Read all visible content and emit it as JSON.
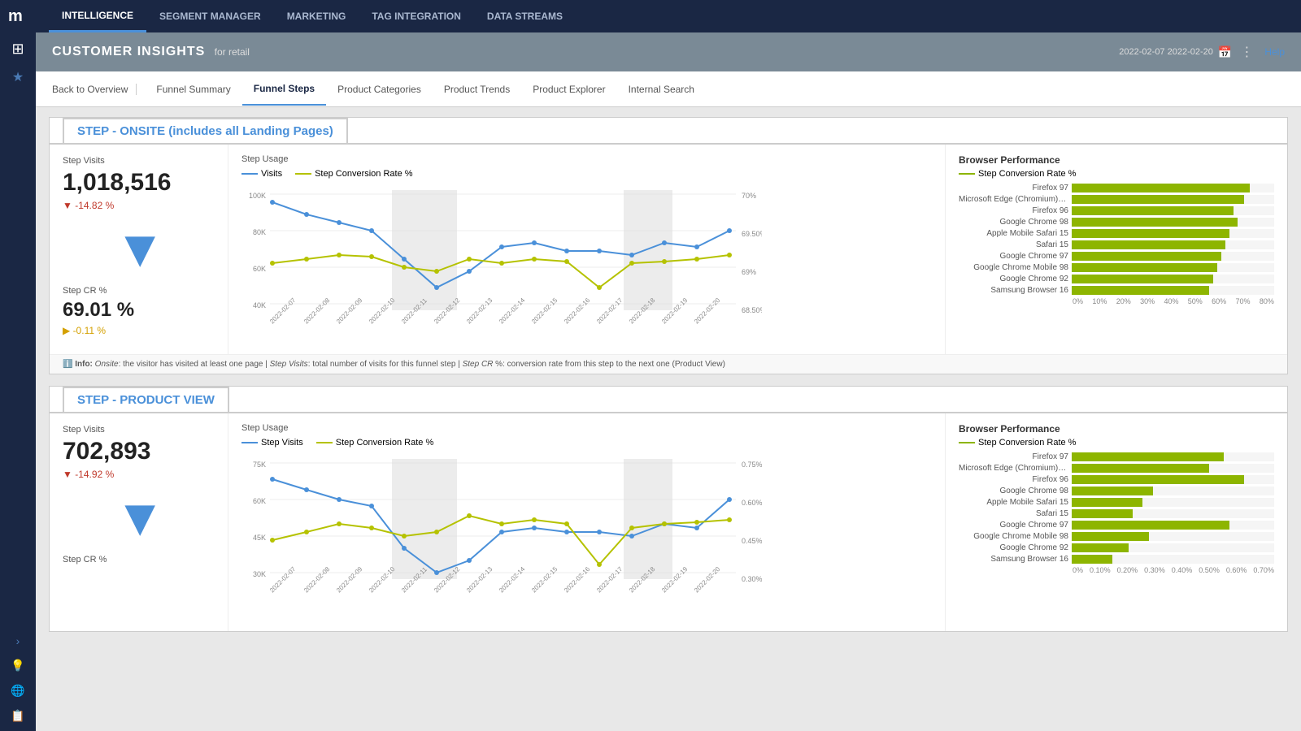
{
  "nav": {
    "logo": "m",
    "items": [
      "INTELLIGENCE",
      "SEGMENT MANAGER",
      "MARKETING",
      "TAG INTEGRATION",
      "DATA STREAMS"
    ],
    "active": "INTELLIGENCE"
  },
  "date_range": "2022-02-07 2022-02-20",
  "header": {
    "title": "CUSTOMER INSIGHTS",
    "subtitle": "for retail",
    "help": "Help"
  },
  "tabs": {
    "back": "Back to Overview",
    "items": [
      "Funnel Summary",
      "Funnel Steps",
      "Product Categories",
      "Product Trends",
      "Product Explorer",
      "Internal Search"
    ],
    "active": "Funnel Steps"
  },
  "step1": {
    "title": "STEP - ONSITE (includes all Landing Pages)",
    "visits_label": "Step Visits",
    "visits_value": "1,018,516",
    "visits_change": "▼ -14.82 %",
    "cr_label": "Step CR %",
    "cr_value": "69.01 %",
    "cr_change": "▶ -0.11 %",
    "usage_title": "Step Usage",
    "legend_visits": "Visits",
    "legend_cr": "Step Conversion Rate %",
    "browser_title": "Browser Performance",
    "browser_legend": "Step Conversion Rate %",
    "browsers": [
      {
        "name": "Firefox 97",
        "pct": 88
      },
      {
        "name": "Microsoft Edge (Chromium) fo...",
        "pct": 85
      },
      {
        "name": "Firefox 96",
        "pct": 80
      },
      {
        "name": "Google Chrome 98",
        "pct": 82
      },
      {
        "name": "Apple Mobile Safari 15",
        "pct": 78
      },
      {
        "name": "Safari 15",
        "pct": 76
      },
      {
        "name": "Google Chrome 97",
        "pct": 74
      },
      {
        "name": "Google Chrome Mobile 98",
        "pct": 72
      },
      {
        "name": "Google Chrome 92",
        "pct": 70
      },
      {
        "name": "Samsung Browser 16",
        "pct": 68
      }
    ],
    "axis_labels": [
      "0%",
      "10%",
      "20%",
      "30%",
      "40%",
      "50%",
      "60%",
      "70%",
      "80%"
    ],
    "info": "Info: Onsite: the visitor has visited at least one page | Step Visits: total number of visits for this funnel step | Step CR %: conversion rate from this step to the next one (Product View)"
  },
  "step2": {
    "title": "STEP - PRODUCT VIEW",
    "visits_label": "Step Visits",
    "visits_value": "702,893",
    "visits_change": "▼ -14.92 %",
    "cr_label": "Step CR %",
    "usage_title": "Step Usage",
    "legend_visits": "Step Visits",
    "legend_cr": "Step Conversion Rate %",
    "browser_title": "Browser Performance",
    "browser_legend": "Step Conversion Rate %",
    "browsers": [
      {
        "name": "Firefox 97",
        "pct": 75
      },
      {
        "name": "Microsoft Edge (Chromium) fo...",
        "pct": 68
      },
      {
        "name": "Firefox 96",
        "pct": 85
      },
      {
        "name": "Google Chrome 98",
        "pct": 40
      },
      {
        "name": "Apple Mobile Safari 15",
        "pct": 35
      },
      {
        "name": "Safari 15",
        "pct": 30
      },
      {
        "name": "Google Chrome 97",
        "pct": 78
      },
      {
        "name": "Google Chrome Mobile 98",
        "pct": 38
      },
      {
        "name": "Google Chrome 92",
        "pct": 28
      },
      {
        "name": "Samsung Browser 16",
        "pct": 20
      }
    ],
    "axis_labels": [
      "0%",
      "0.10%",
      "0.20%",
      "0.30%",
      "0.40%",
      "0.50%",
      "0.60%",
      "0.70%"
    ]
  }
}
